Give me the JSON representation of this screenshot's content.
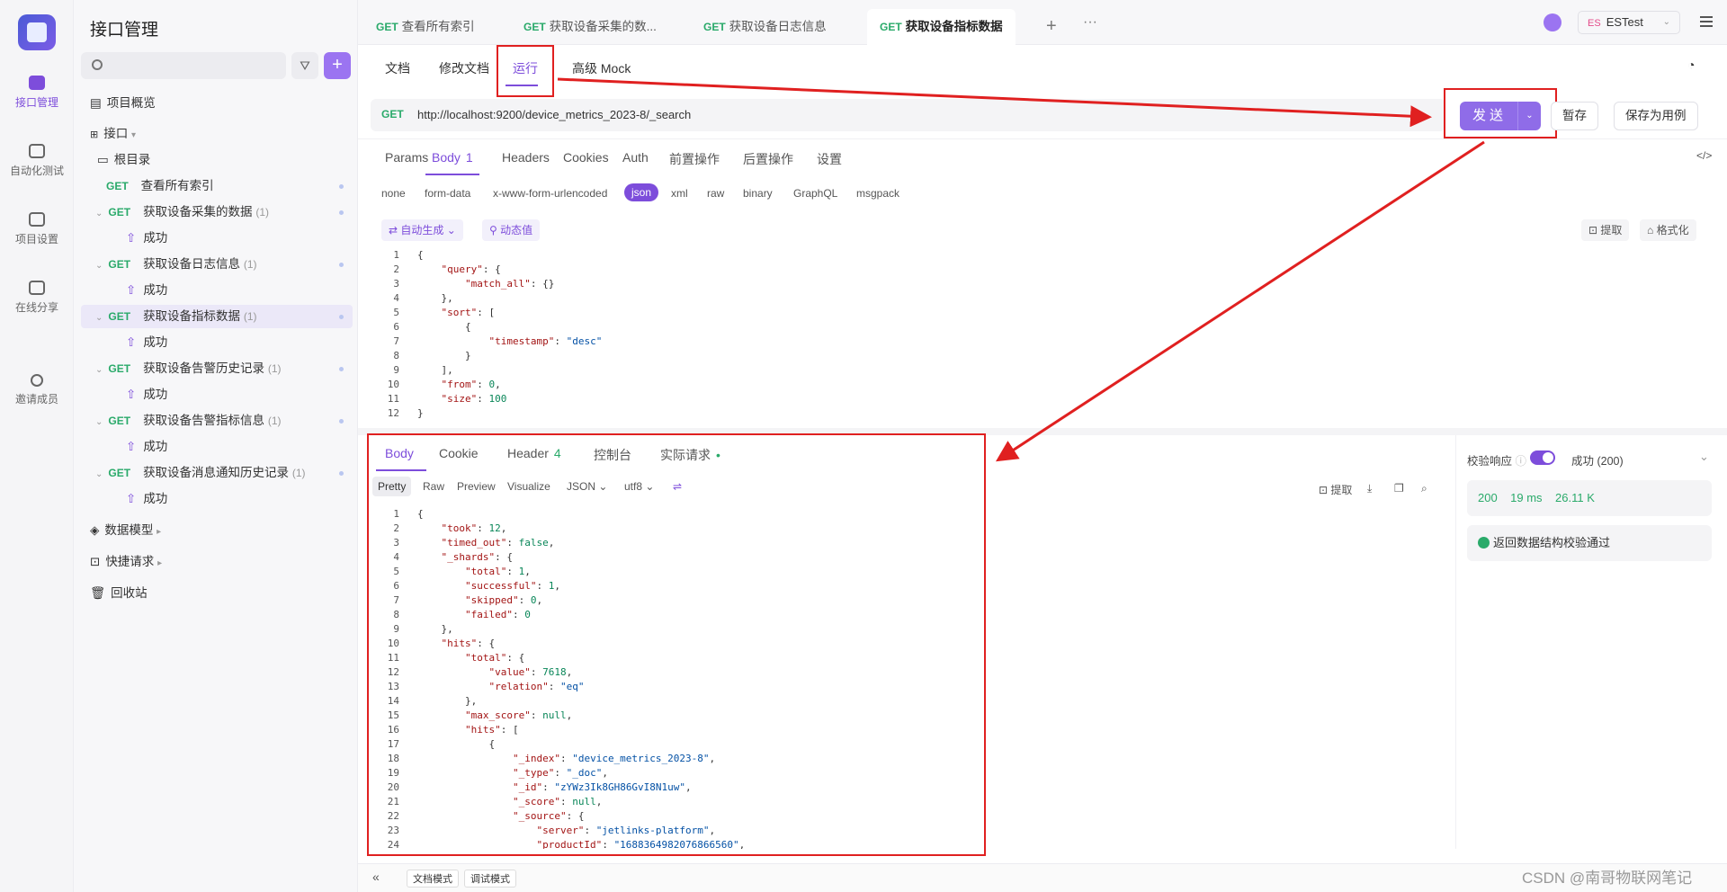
{
  "rail": {
    "items": [
      {
        "label": "接口管理"
      },
      {
        "label": "自动化测试"
      },
      {
        "label": "项目设置"
      },
      {
        "label": "在线分享"
      },
      {
        "label": "邀请成员"
      }
    ]
  },
  "sidebar": {
    "title": "接口管理",
    "search_placeholder": "",
    "add_label": "+",
    "overview": "项目概览",
    "interfaces": "接口",
    "root": "根目录",
    "endpoints": [
      {
        "method": "GET",
        "name": "查看所有索引",
        "count": "",
        "child": ""
      },
      {
        "method": "GET",
        "name": "获取设备采集的数据",
        "count": "(1)",
        "child": "成功"
      },
      {
        "method": "GET",
        "name": "获取设备日志信息",
        "count": "(1)",
        "child": "成功"
      },
      {
        "method": "GET",
        "name": "获取设备指标数据",
        "count": "(1)",
        "child": "成功"
      },
      {
        "method": "GET",
        "name": "获取设备告警历史记录",
        "count": "(1)",
        "child": "成功"
      },
      {
        "method": "GET",
        "name": "获取设备告警指标信息",
        "count": "(1)",
        "child": "成功"
      },
      {
        "method": "GET",
        "name": "获取设备消息通知历史记录",
        "count": "(1)",
        "child": "成功"
      }
    ],
    "data_model": "数据模型",
    "quick_request": "快捷请求",
    "recycle": "回收站"
  },
  "tabs": [
    {
      "method": "GET",
      "label": "查看所有索引"
    },
    {
      "method": "GET",
      "label": "获取设备采集的数..."
    },
    {
      "method": "GET",
      "label": "获取设备日志信息"
    },
    {
      "method": "GET",
      "label": "获取设备指标数据"
    }
  ],
  "env": {
    "badge": "ES",
    "name": "ESTest"
  },
  "subtabs": [
    "文档",
    "修改文档",
    "运行",
    "高级 Mock"
  ],
  "request": {
    "method": "GET",
    "url": "http://localhost:9200/device_metrics_2023-8/_search",
    "send": "发送",
    "save": "暂存",
    "save_case": "保存为用例"
  },
  "req_tabs": [
    {
      "label": "Params",
      "badge": ""
    },
    {
      "label": "Body",
      "badge": "1"
    },
    {
      "label": "Headers",
      "badge": ""
    },
    {
      "label": "Cookies",
      "badge": ""
    },
    {
      "label": "Auth",
      "badge": ""
    },
    {
      "label": "前置操作",
      "badge": ""
    },
    {
      "label": "后置操作",
      "badge": ""
    },
    {
      "label": "设置",
      "badge": ""
    }
  ],
  "body_types": [
    "none",
    "form-data",
    "x-www-form-urlencoded",
    "json",
    "xml",
    "raw",
    "binary",
    "GraphQL",
    "msgpack"
  ],
  "body_tools": {
    "auto_gen": "自动生成",
    "dynamic": "动态值",
    "extract": "提取",
    "format": "格式化"
  },
  "request_body_lines": [
    "{",
    "    \"query\": {",
    "        \"match_all\": {}",
    "    },",
    "    \"sort\": [",
    "        {",
    "            \"timestamp\": \"desc\"",
    "        }",
    "    ],",
    "    \"from\": 0,",
    "    \"size\": 100",
    "}"
  ],
  "resp_tabs": [
    {
      "label": "Body",
      "badge": ""
    },
    {
      "label": "Cookie",
      "badge": ""
    },
    {
      "label": "Header",
      "badge": "4"
    },
    {
      "label": "控制台",
      "badge": ""
    },
    {
      "label": "实际请求",
      "badge": "•"
    }
  ],
  "view_modes": [
    "Pretty",
    "Raw",
    "Preview",
    "Visualize",
    "JSON",
    "utf8"
  ],
  "resp_tools": {
    "extract": "提取"
  },
  "response_body_lines": [
    "{",
    "    \"took\": 12,",
    "    \"timed_out\": false,",
    "    \"_shards\": {",
    "        \"total\": 1,",
    "        \"successful\": 1,",
    "        \"skipped\": 0,",
    "        \"failed\": 0",
    "    },",
    "    \"hits\": {",
    "        \"total\": {",
    "            \"value\": 7618,",
    "            \"relation\": \"eq\"",
    "        },",
    "        \"max_score\": null,",
    "        \"hits\": [",
    "            {",
    "                \"_index\": \"device_metrics_2023-8\",",
    "                \"_type\": \"_doc\",",
    "                \"_id\": \"zYWz3Ik8GH86GvI8N1uw\",",
    "                \"_score\": null,",
    "                \"_source\": {",
    "                    \"server\": \"jetlinks-platform\",",
    "                    \"productId\": \"1688364982076866560\","
  ],
  "validation": {
    "label": "校验响应",
    "status": "成功 (200)",
    "code": "200",
    "time": "19 ms",
    "size": "26.11 K",
    "pass_text": "返回数据结构校验通过"
  },
  "footer": {
    "doc_mode": "文档模式",
    "debug_mode": "调试模式"
  },
  "watermark": "CSDN @南哥物联网笔记"
}
